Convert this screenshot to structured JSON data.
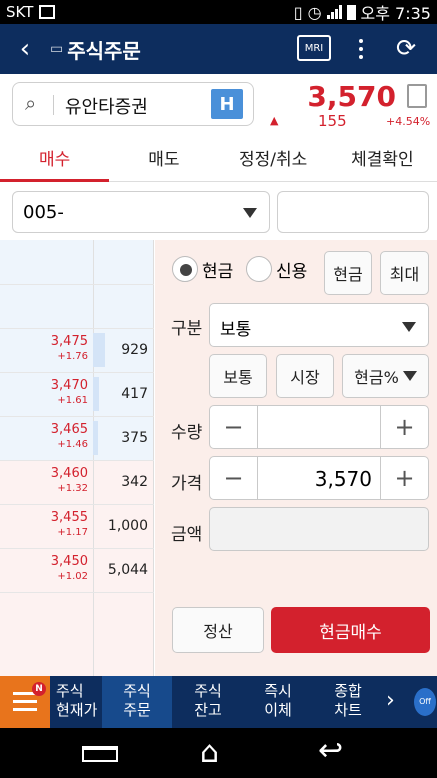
{
  "status_bar": {
    "carrier": "SKT",
    "time": "오후 7:35"
  },
  "header": {
    "title": "주식주문",
    "mri_label": "MRI"
  },
  "stock": {
    "name": "유안타증권",
    "market_badge": "H",
    "price": "3,570",
    "change": "155",
    "change_pct": "+4.54%"
  },
  "tabs": [
    {
      "label": "매수",
      "active": true
    },
    {
      "label": "매도",
      "active": false
    },
    {
      "label": "정정/취소",
      "active": false
    },
    {
      "label": "체결확인",
      "active": false
    }
  ],
  "account": {
    "value": "005-",
    "password_placeholder": ""
  },
  "order_book": {
    "rows": [
      {
        "price": "3,475",
        "rate": "+1.76",
        "qty": "929"
      },
      {
        "price": "3,470",
        "rate": "+1.61",
        "qty": "417"
      },
      {
        "price": "3,465",
        "rate": "+1.46",
        "qty": "375"
      },
      {
        "price": "3,460",
        "rate": "+1.32",
        "qty": "342"
      },
      {
        "price": "3,455",
        "rate": "+1.17",
        "qty": "1,000"
      },
      {
        "price": "3,450",
        "rate": "+1.02",
        "qty": "5,044"
      }
    ]
  },
  "order_form": {
    "radio_cash": "현금",
    "radio_credit": "신용",
    "btn_cash": "현금",
    "btn_max": "최대",
    "label_type": "구분",
    "type_value": "보통",
    "btn_normal": "보통",
    "btn_market": "시장",
    "btn_cash_pct": "현금%",
    "label_qty": "수량",
    "qty_value": "",
    "label_price": "가격",
    "price_value": "3,570",
    "label_amount": "금액",
    "amount_value": "",
    "btn_settle": "정산",
    "btn_buy": "현금매수"
  },
  "bottom_menu": {
    "badge": "N",
    "items": [
      {
        "line1": "주식",
        "line2": "현재가"
      },
      {
        "line1": "주식",
        "line2": "주문"
      },
      {
        "line1": "주식",
        "line2": "잔고"
      },
      {
        "line1": "즉시",
        "line2": "이체"
      },
      {
        "line1": "종합",
        "line2": "차트"
      }
    ],
    "off_label": "Off"
  },
  "colors": {
    "navy": "#0d2d5e",
    "red": "#d3212d",
    "orange": "#e8741c",
    "blue_badge": "#4a90d9"
  }
}
